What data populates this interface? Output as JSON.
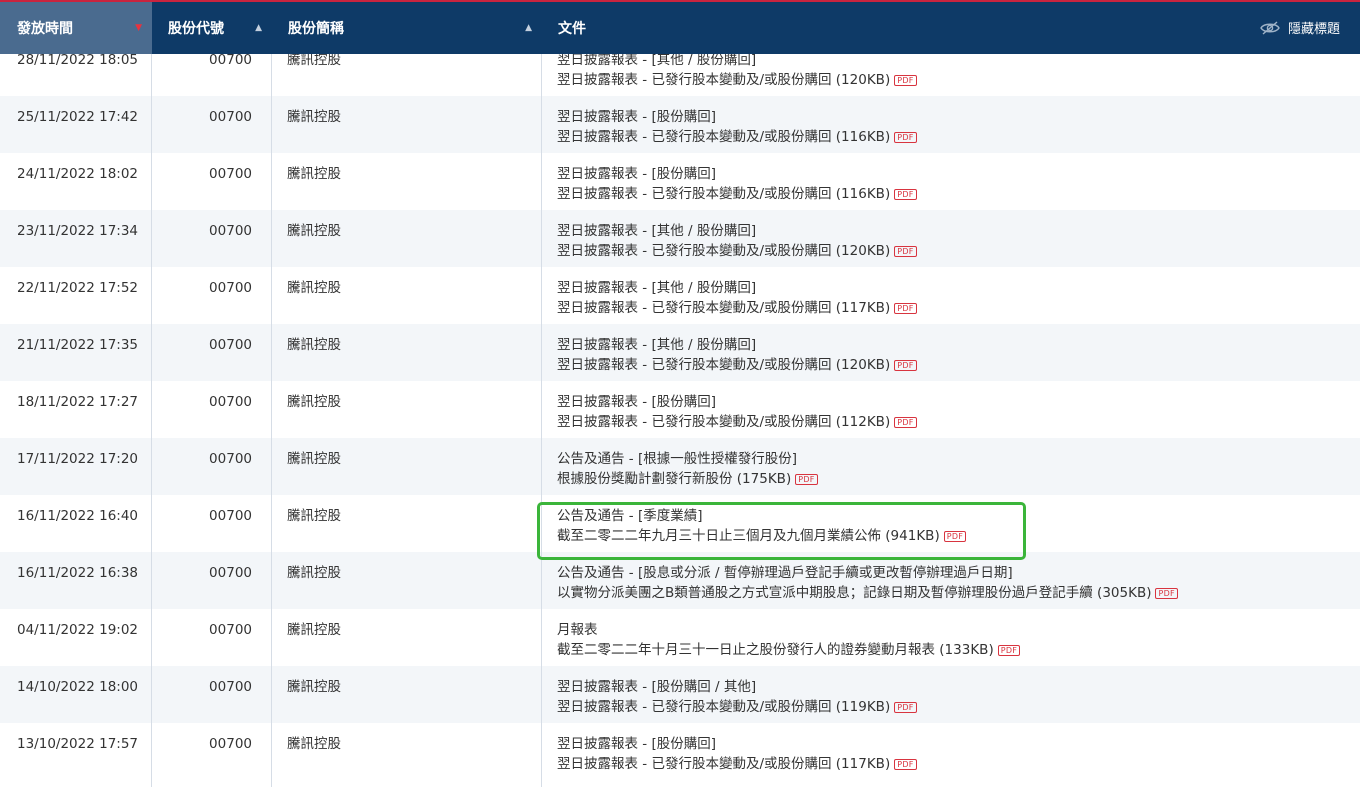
{
  "header": {
    "col_time": "發放時間",
    "col_code": "股份代號",
    "col_name": "股份簡稱",
    "col_doc": "文件",
    "hide_title": "隱藏標題"
  },
  "icons": {
    "sort_active": "sort-desc-icon",
    "sort": "sort-asc-icon",
    "hide": "eye-slash-icon",
    "pdf": "pdf-icon"
  },
  "colors": {
    "header_bg": "#0e3a67",
    "active_col_bg": "#4a6b8f",
    "pdf": "#d8343f",
    "highlight": "#3bb53a",
    "alt_row": "#f3f6f9"
  },
  "pdf_label": "PDF",
  "rows": [
    {
      "date": "28/11/2022 18:05",
      "code": "00700",
      "name": "騰訊控股",
      "title": "翌日披露報表 - [其他 / 股份購回]",
      "doc": "翌日披露報表 - 已發行股本變動及/或股份購回 (120KB)"
    },
    {
      "date": "25/11/2022 17:42",
      "code": "00700",
      "name": "騰訊控股",
      "title": "翌日披露報表 - [股份購回]",
      "doc": "翌日披露報表 - 已發行股本變動及/或股份購回 (116KB)"
    },
    {
      "date": "24/11/2022 18:02",
      "code": "00700",
      "name": "騰訊控股",
      "title": "翌日披露報表 - [股份購回]",
      "doc": "翌日披露報表 - 已發行股本變動及/或股份購回 (116KB)"
    },
    {
      "date": "23/11/2022 17:34",
      "code": "00700",
      "name": "騰訊控股",
      "title": "翌日披露報表 - [其他 / 股份購回]",
      "doc": "翌日披露報表 - 已發行股本變動及/或股份購回 (120KB)"
    },
    {
      "date": "22/11/2022 17:52",
      "code": "00700",
      "name": "騰訊控股",
      "title": "翌日披露報表 - [其他 / 股份購回]",
      "doc": "翌日披露報表 - 已發行股本變動及/或股份購回 (117KB)"
    },
    {
      "date": "21/11/2022 17:35",
      "code": "00700",
      "name": "騰訊控股",
      "title": "翌日披露報表 - [其他 / 股份購回]",
      "doc": "翌日披露報表 - 已發行股本變動及/或股份購回 (120KB)"
    },
    {
      "date": "18/11/2022 17:27",
      "code": "00700",
      "name": "騰訊控股",
      "title": "翌日披露報表 - [股份購回]",
      "doc": "翌日披露報表 - 已發行股本變動及/或股份購回 (112KB)"
    },
    {
      "date": "17/11/2022 17:20",
      "code": "00700",
      "name": "騰訊控股",
      "title": "公告及通告 - [根據一般性授權發行股份]",
      "doc": "根據股份獎勵計劃發行新股份 (175KB)"
    },
    {
      "date": "16/11/2022 16:40",
      "code": "00700",
      "name": "騰訊控股",
      "title": "公告及通告 - [季度業績]",
      "doc": "截至二零二二年九月三十日止三個月及九個月業績公佈 (941KB)"
    },
    {
      "date": "16/11/2022 16:38",
      "code": "00700",
      "name": "騰訊控股",
      "title": "公告及通告 - [股息或分派 / 暫停辦理過戶登記手續或更改暫停辦理過戶日期]",
      "doc": "以實物分派美團之B類普通股之方式宣派中期股息；記錄日期及暫停辦理股份過戶登記手續 (305KB)"
    },
    {
      "date": "04/11/2022 19:02",
      "code": "00700",
      "name": "騰訊控股",
      "title": "月報表",
      "doc": "截至二零二二年十月三十一日止之股份發行人的證券變動月報表 (133KB)"
    },
    {
      "date": "14/10/2022 18:00",
      "code": "00700",
      "name": "騰訊控股",
      "title": "翌日披露報表 - [股份購回 / 其他]",
      "doc": "翌日披露報表 - 已發行股本變動及/或股份購回 (119KB)"
    },
    {
      "date": "13/10/2022 17:57",
      "code": "00700",
      "name": "騰訊控股",
      "title": "翌日披露報表 - [股份購回]",
      "doc": "翌日披露報表 - 已發行股本變動及/或股份購回 (117KB)"
    }
  ]
}
